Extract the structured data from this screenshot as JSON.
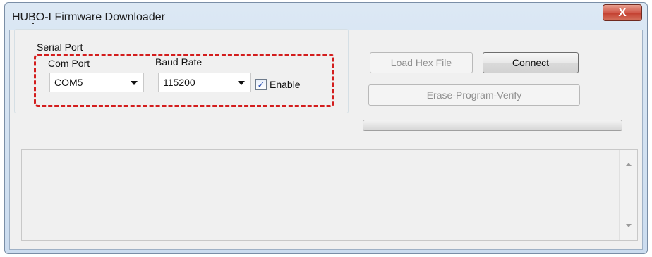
{
  "window": {
    "title": "HUBO-I Firmware Downloader",
    "close_glyph": "X"
  },
  "serial_port": {
    "group_label": "Serial Port",
    "com_port": {
      "label": "Com Port",
      "value": "COM5"
    },
    "baud_rate": {
      "label": "Baud Rate",
      "value": "115200"
    },
    "enable": {
      "label": "Enable",
      "checked": true,
      "check_glyph": "✓"
    }
  },
  "buttons": {
    "load_hex": "Load Hex File",
    "connect": "Connect",
    "erase_program_verify": "Erase-Program-Verify"
  },
  "progress": {
    "value_percent": 0
  },
  "colors": {
    "highlight": "#d31d1d",
    "close_button": "#c23c2d"
  },
  "icons": {
    "close": "close-icon",
    "dropdown": "chevron-down-icon",
    "checkbox": "checkmark-icon",
    "scroll_up": "scroll-up-icon",
    "scroll_down": "scroll-down-icon"
  }
}
